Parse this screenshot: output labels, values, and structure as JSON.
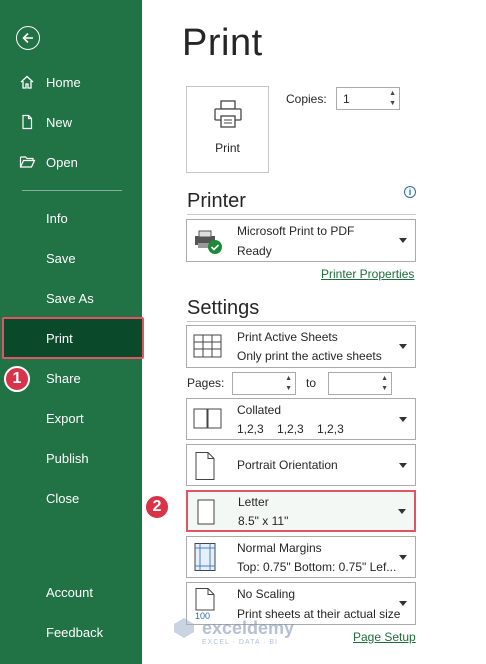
{
  "sidebar": {
    "items": [
      {
        "label": "Home",
        "icon": "home-icon"
      },
      {
        "label": "New",
        "icon": "new-document-icon"
      },
      {
        "label": "Open",
        "icon": "folder-open-icon"
      },
      {
        "label": "Info"
      },
      {
        "label": "Save"
      },
      {
        "label": "Save As"
      },
      {
        "label": "Print",
        "active": true
      },
      {
        "label": "Share"
      },
      {
        "label": "Export"
      },
      {
        "label": "Publish"
      },
      {
        "label": "Close"
      },
      {
        "label": "Account"
      },
      {
        "label": "Feedback"
      }
    ],
    "bg_color": "#217346",
    "active_color": "#0a4a2b"
  },
  "markers": {
    "m1": "1",
    "m2": "2",
    "color": "#d9334a"
  },
  "main": {
    "title": "Print",
    "print_button": "Print",
    "copies": {
      "label": "Copies:",
      "value": "1"
    },
    "printer": {
      "heading": "Printer",
      "name": "Microsoft Print to PDF",
      "status": "Ready",
      "properties_link": "Printer Properties"
    },
    "settings": {
      "heading": "Settings",
      "what": {
        "line1": "Print Active Sheets",
        "line2": "Only print the active sheets"
      },
      "pages": {
        "label": "Pages:",
        "to": "to",
        "from_value": "",
        "to_value": ""
      },
      "collate": {
        "line1": "Collated",
        "line2": "1,2,3    1,2,3    1,2,3"
      },
      "orientation": {
        "line1": "Portrait Orientation"
      },
      "paper": {
        "line1": "Letter",
        "line2": "8.5\" x 11\""
      },
      "margins": {
        "line1": "Normal Margins",
        "line2": "Top: 0.75\" Bottom: 0.75\" Lef..."
      },
      "scaling": {
        "line1": "No Scaling",
        "line2": "Print sheets at their actual size",
        "icon_text": "100"
      },
      "page_setup_link": "Page Setup"
    }
  },
  "watermark": {
    "name": "exceldemy",
    "tagline": "EXCEL · DATA · BI"
  }
}
